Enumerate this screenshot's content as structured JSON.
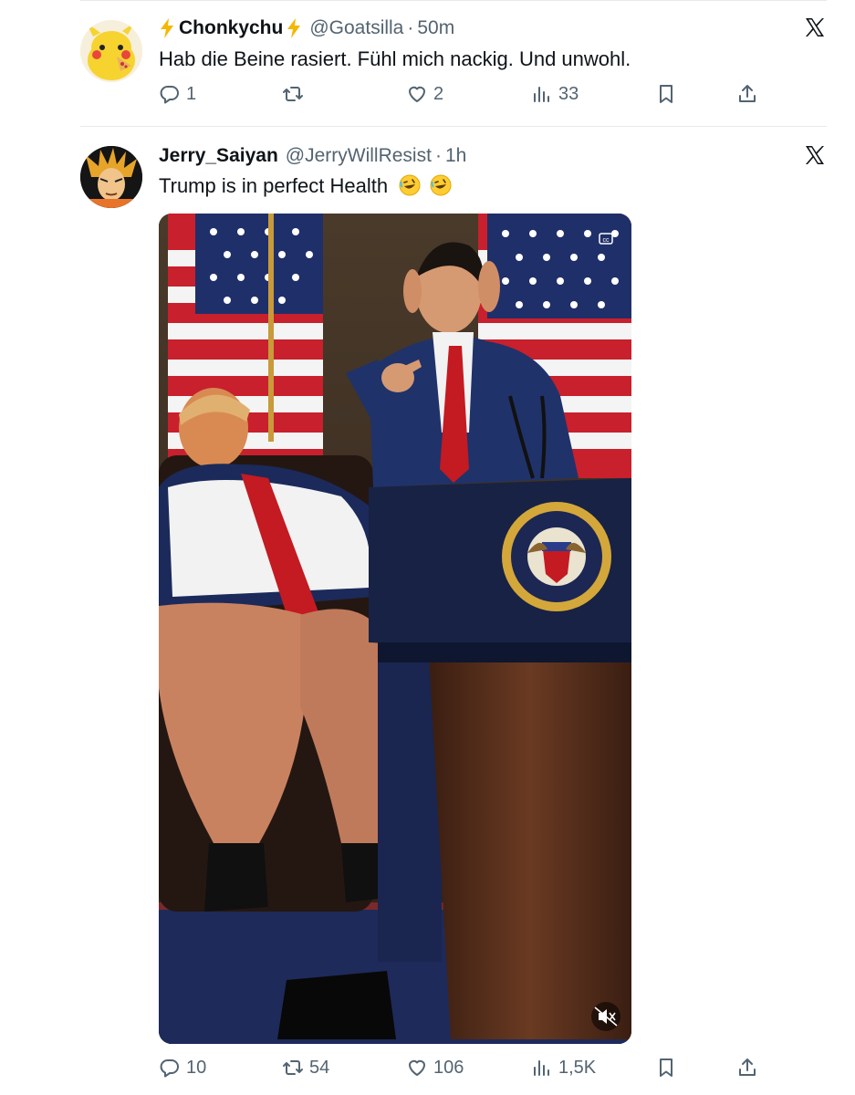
{
  "tweets": [
    {
      "display_name": "Chonkychu",
      "handle": "@Goatsilla",
      "separator": "·",
      "time": "50m",
      "text": "Hab die Beine rasiert. Fühl mich nackig. Und unwohl.",
      "replies": "1",
      "retweets": "",
      "likes": "2",
      "views": "33"
    },
    {
      "display_name": "Jerry_Saiyan",
      "handle": "@JerryWillResist",
      "separator": "·",
      "time": "1h",
      "text": "Trump is in perfect Health",
      "replies": "10",
      "retweets": "54",
      "likes": "106",
      "views": "1,5K"
    }
  ],
  "media": {
    "seal_text": "PRESIDENT OF THE UNITED STATES",
    "captions_badge": "cc"
  },
  "icons": {
    "reply": "reply-icon",
    "retweet": "retweet-icon",
    "like": "heart-icon",
    "views": "views-icon",
    "bookmark": "bookmark-icon",
    "share": "share-icon",
    "platform": "x-logo-icon"
  },
  "colors": {
    "text_primary": "#0f1419",
    "text_secondary": "#536471",
    "separator": "#e7e9ea",
    "bolt": "#f5b700"
  }
}
